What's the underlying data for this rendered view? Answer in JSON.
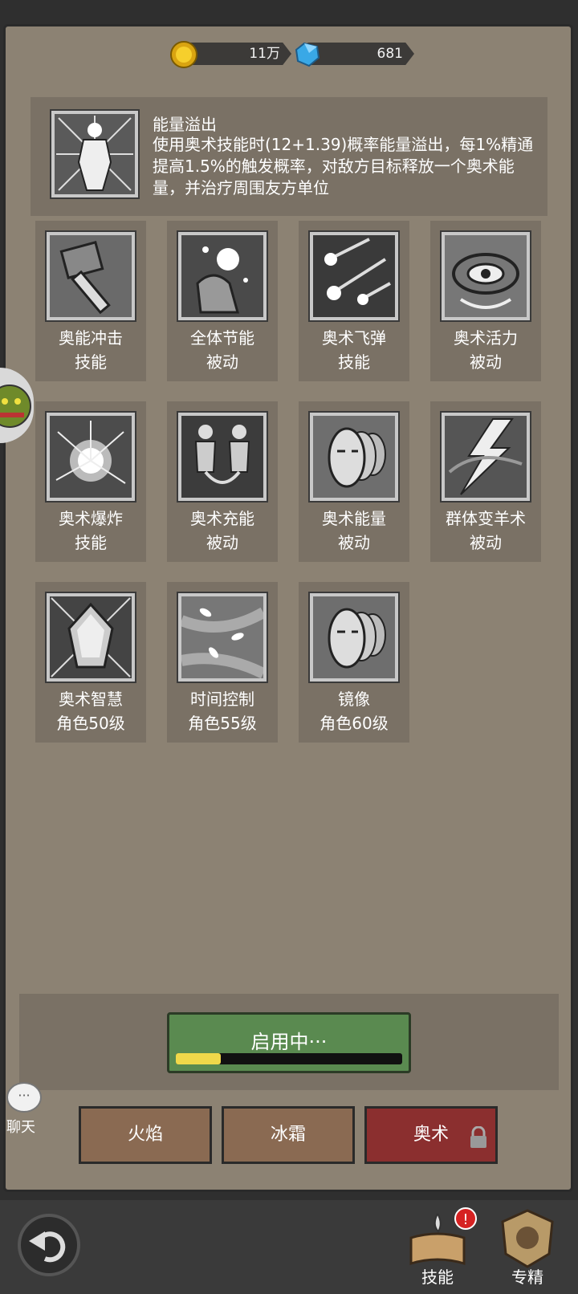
{
  "resources": {
    "coins": "11万",
    "gems": "681"
  },
  "selected_talent": {
    "name": "能量溢出",
    "description": "使用奥术技能时(12+1.39)概率能量溢出，每1%精通提高1.5%的触发概率，对敌方目标释放一个奥术能量，并治疗周围友方单位"
  },
  "talents": [
    {
      "name": "奥能冲击",
      "type": "技能",
      "icon": "hammer-icon"
    },
    {
      "name": "全体节能",
      "type": "被动",
      "icon": "orb-hand-icon"
    },
    {
      "name": "奥术飞弹",
      "type": "技能",
      "icon": "missiles-icon"
    },
    {
      "name": "奥术活力",
      "type": "被动",
      "icon": "eye-swirl-icon"
    },
    {
      "name": "奥术爆炸",
      "type": "技能",
      "icon": "explosion-icon"
    },
    {
      "name": "奥术充能",
      "type": "被动",
      "icon": "figures-icon"
    },
    {
      "name": "奥术能量",
      "type": "被动",
      "icon": "faces-icon"
    },
    {
      "name": "群体变羊术",
      "type": "被动",
      "icon": "lightning-icon"
    },
    {
      "name": "奥术智慧",
      "type": "角色50级",
      "icon": "crystal-icon"
    },
    {
      "name": "时间控制",
      "type": "角色55级",
      "icon": "leaves-icon"
    },
    {
      "name": "镜像",
      "type": "角色60级",
      "icon": "mirror-faces-icon"
    }
  ],
  "activate": {
    "label": "启用中···",
    "progress": 0.2
  },
  "tabs": {
    "fire": "火焰",
    "frost": "冰霜",
    "arcane": "奥术"
  },
  "chat": {
    "bubble": "···",
    "label": "聊天"
  },
  "nav": {
    "skill": "技能",
    "spec": "专精",
    "badge": "!"
  },
  "colors": {
    "panel": "#8c8273",
    "tile": "#7a7165",
    "active_tab": "#8b2f2f",
    "button_green": "#5a8a50",
    "progress_yellow": "#f0d84a"
  }
}
